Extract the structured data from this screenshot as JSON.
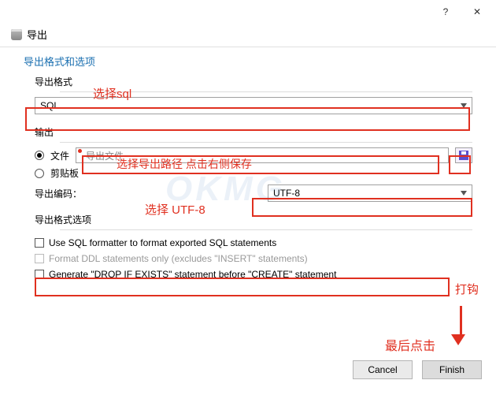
{
  "titlebar": {
    "help": "?",
    "close": "✕"
  },
  "dialog": {
    "title": "导出"
  },
  "section": {
    "header": "导出格式和选项"
  },
  "annotations": {
    "select_sql": "选择sql",
    "select_path": "选择导出路径  点击右侧保存",
    "select_utf8": "选择 UTF-8",
    "check_it": "打钩",
    "finally_click": "最后点击"
  },
  "groups": {
    "format_label": "导出格式",
    "output_label": "输出",
    "encoding_label": "导出编码：",
    "options_label": "导出格式选项"
  },
  "format": {
    "value": "SQL"
  },
  "output": {
    "file_label": "文件",
    "clipboard_label": "剪贴板",
    "path_placeholder": "导出文件"
  },
  "encoding": {
    "value": "UTF-8"
  },
  "options": {
    "use_formatter": "Use SQL formatter to format exported SQL statements",
    "ddl_only": "Format DDL statements only (excludes \"INSERT\" statements)",
    "drop_if_exists": "Generate \"DROP IF EXISTS\" statement before \"CREATE\" statement"
  },
  "buttons": {
    "cancel": "Cancel",
    "finish": "Finish"
  },
  "watermark": "OKMG"
}
